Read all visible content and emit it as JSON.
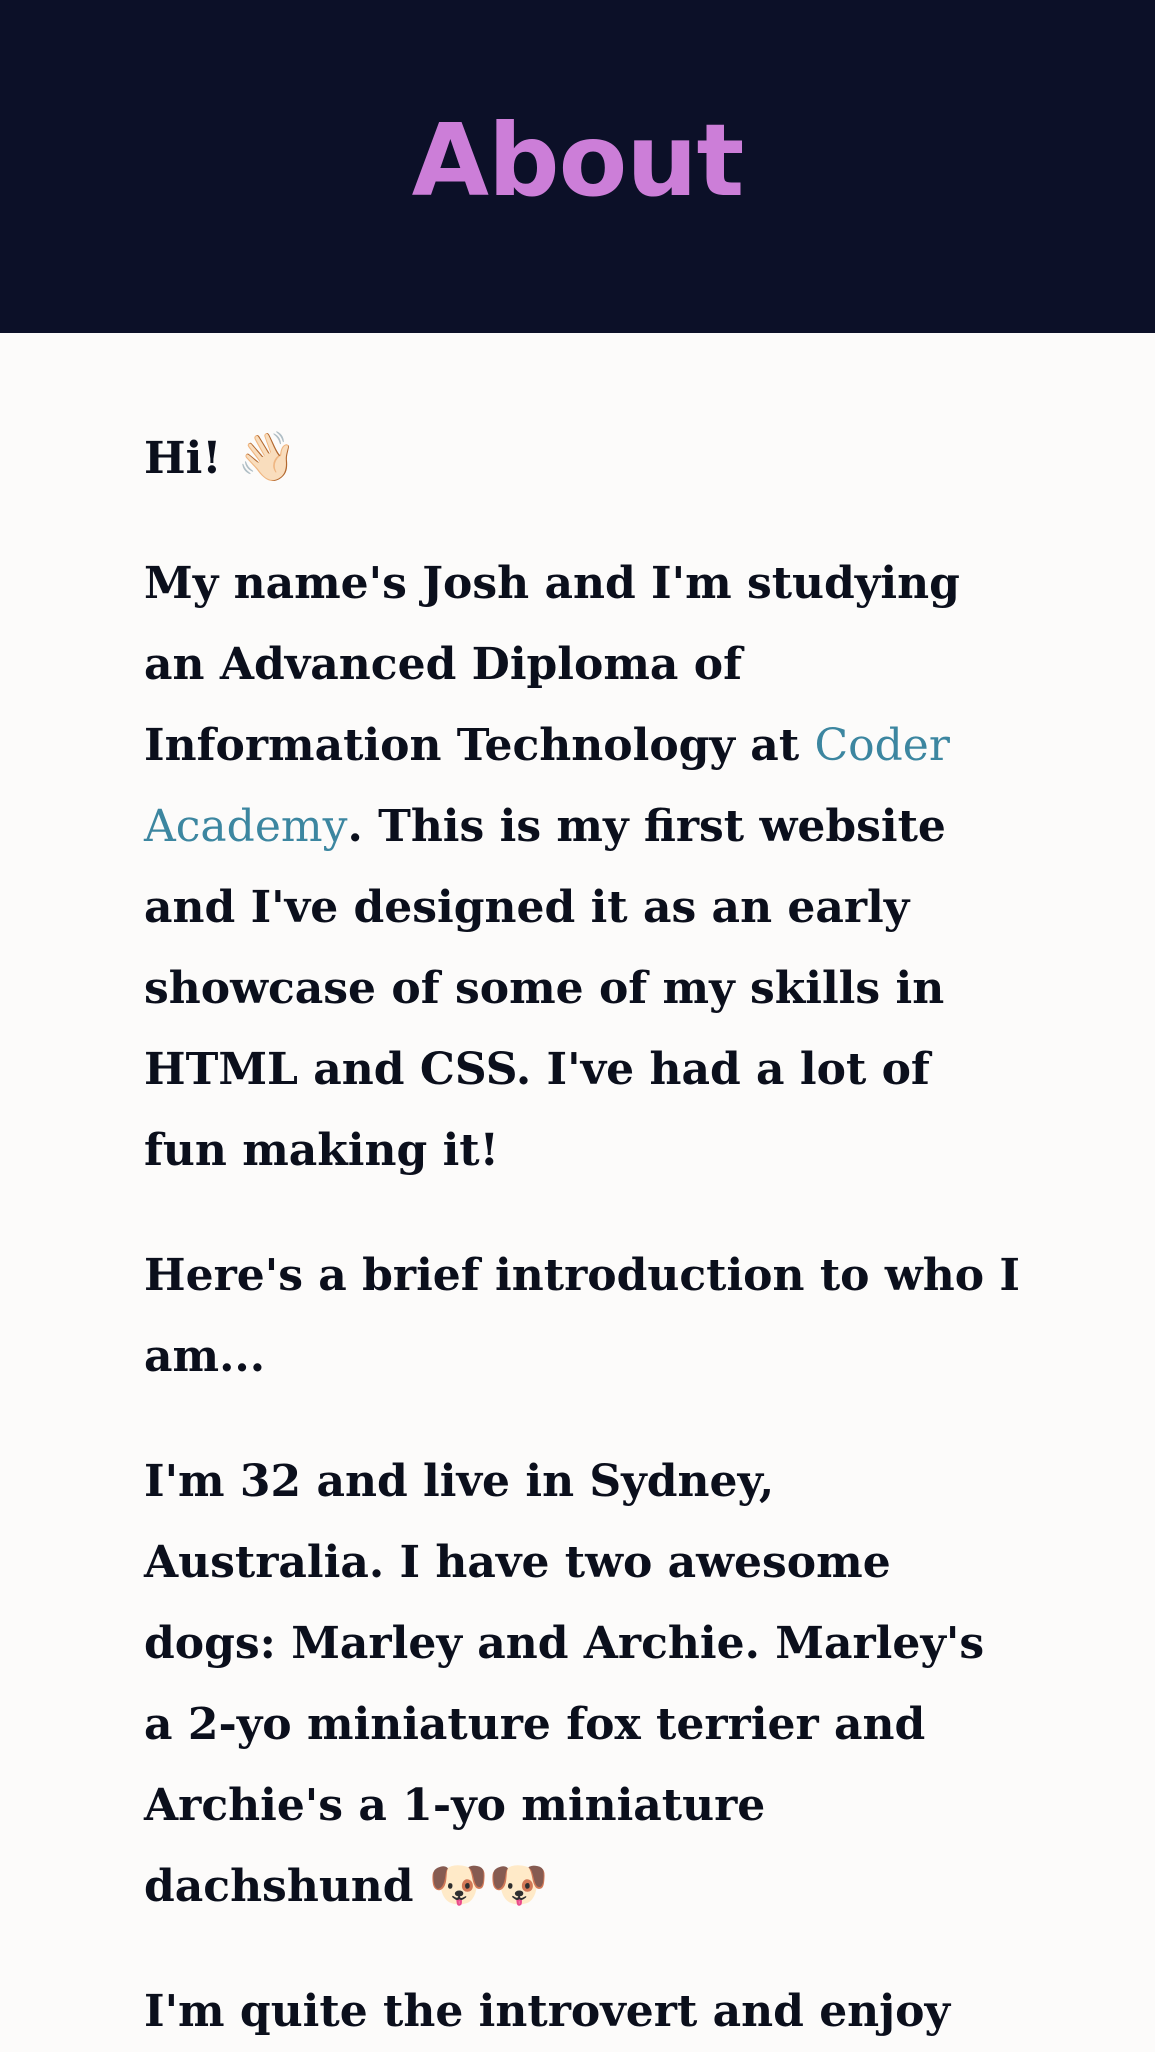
{
  "header": {
    "title": "About"
  },
  "paragraphs": [
    {
      "text": "Hi!",
      "emoji": [
        "👋🏻"
      ]
    },
    {
      "before_link": "My name's Josh and I'm studying an Advanced Diploma of Information Technology at ",
      "link_text": "Coder Academy",
      "after_link": ". This is my first website and I've designed it as an early showcase of some of my skills in HTML and CSS. I've had a lot of fun making it!"
    },
    {
      "text": "Here's a brief introduction to who I am..."
    },
    {
      "text": "I'm 32 and live in Sydney, Australia. I have two awesome dogs: Marley and Archie. Marley's a 2-yo miniature fox terrier and Archie's a 1-yo miniature dachshund",
      "emoji": [
        "🐶",
        "🐶"
      ]
    },
    {
      "text": "I'm quite the introvert and enjoy"
    }
  ],
  "colors": {
    "header_bg": "#0c1028",
    "title": "#cc7ed8",
    "page_bg": "#fcfbfa",
    "text": "#0b0f1c",
    "link": "#3c86a0"
  }
}
